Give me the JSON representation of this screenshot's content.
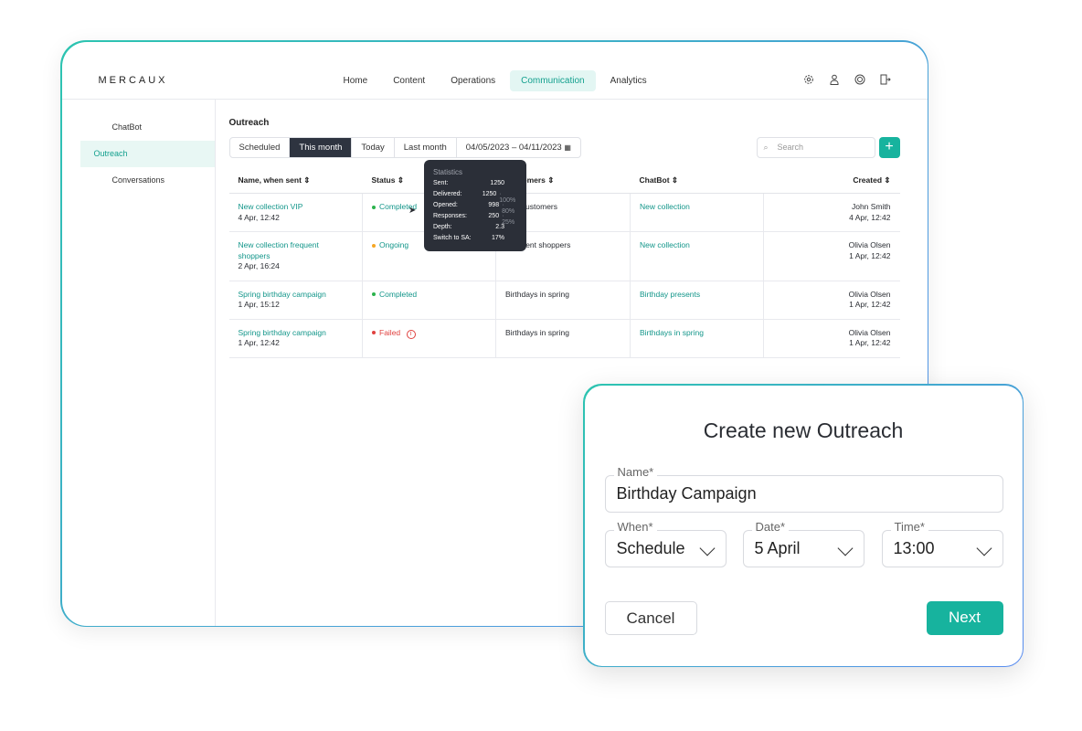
{
  "app": {
    "logo": "MERCAUX",
    "nav": [
      "Home",
      "Content",
      "Operations",
      "Communication",
      "Analytics"
    ],
    "nav_active": "Communication",
    "icons": [
      "gear-icon",
      "user-icon",
      "globe-icon",
      "logout-icon"
    ]
  },
  "sidebar": {
    "items": [
      "ChatBot",
      "Outreach",
      "Conversations"
    ],
    "active": "Outreach"
  },
  "main": {
    "title": "Outreach",
    "filters": [
      "Scheduled",
      "This month",
      "Today",
      "Last month"
    ],
    "active_filter": "This month",
    "date_range": "04/05/2023 – 04/11/2023",
    "search_placeholder": "Search",
    "add_label": "+",
    "columns": [
      "Name, when sent ⇕",
      "Status ⇕",
      "Customers ⇕",
      "ChatBot ⇕",
      "Created ⇕"
    ],
    "rows": [
      {
        "name": "New collection VIP",
        "when": "4 Apr, 12:42",
        "status": "Completed",
        "status_color": "#2bb24c",
        "customers": "VIP Customers",
        "chatbot": "New collection",
        "creator": "John Smith",
        "created": "4 Apr, 12:42"
      },
      {
        "name": "New collection frequent shoppers",
        "when": "2 Apr, 16:24",
        "status": "Ongoing",
        "status_color": "#f5a623",
        "customers": "Frequent shoppers",
        "chatbot": "New collection",
        "creator": "Olivia Olsen",
        "created": "1 Apr, 12:42"
      },
      {
        "name": "Spring birthday campaign",
        "when": "1 Apr, 15:12",
        "status": "Completed",
        "status_color": "#2bb24c",
        "customers": "Birthdays in spring",
        "chatbot": "Birthday presents",
        "creator": "Olivia Olsen",
        "created": "1 Apr, 12:42"
      },
      {
        "name": "Spring birthday campaign",
        "when": "1 Apr, 12:42",
        "status": "Failed",
        "status_color": "#e0413f",
        "customers": "Birthdays in spring",
        "chatbot": "Birthdays in spring",
        "creator": "Olivia Olsen",
        "created": "1 Apr, 12:42"
      }
    ]
  },
  "tooltip": {
    "title": "Statistics",
    "rows": [
      {
        "label": "Sent:",
        "value": "1250",
        "pct": ""
      },
      {
        "label": "Delivered:",
        "value": "1250",
        "pct": "· 100%"
      },
      {
        "label": "Opened:",
        "value": "998",
        "pct": "· 80%"
      },
      {
        "label": "Responses:",
        "value": "250",
        "pct": "· 25%"
      },
      {
        "label": "Depth:",
        "value": "2.3",
        "pct": ""
      },
      {
        "label": "Switch to SA:",
        "value": "17%",
        "pct": ""
      }
    ]
  },
  "modal": {
    "title": "Create new Outreach",
    "name_label": "Name*",
    "name_value": "Birthday Campaign",
    "when_label": "When*",
    "when_value": "Schedule",
    "date_label": "Date*",
    "date_value": "5 April",
    "time_label": "Time*",
    "time_value": "13:00",
    "cancel": "Cancel",
    "next": "Next"
  },
  "colors": {
    "accent": "#17b39e",
    "dark": "#2e3440"
  }
}
